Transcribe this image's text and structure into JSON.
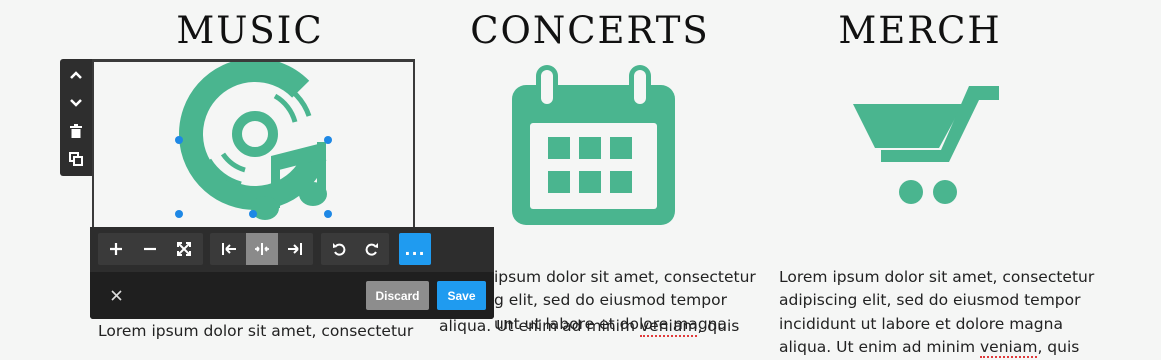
{
  "colors": {
    "accent_green": "#4ab58f",
    "toolbar_dark": "#2d2d2d",
    "active_blue": "#1f9bf0",
    "handle_blue": "#1e88e5",
    "discard_gray": "#8d8d8d"
  },
  "columns": [
    {
      "title": "MUSIC",
      "icon": "music-disc-icon",
      "text": "Lorem ipsum dolor sit amet, consectetur"
    },
    {
      "title": "CONCERTS",
      "icon": "calendar-icon",
      "lines": [
        "ipsum dolor sit amet, consectetur",
        "g elit, sed do eiusmod tempor",
        "unt ut labore et dolore magna",
        "aliqua. Ut enim ad minim ",
        "veniam",
        ", quis"
      ]
    },
    {
      "title": "MERCH",
      "icon": "shopping-cart-icon",
      "lines": [
        "Lorem ipsum dolor sit amet, consectetur",
        "adipiscing elit, sed do eiusmod tempor",
        "incididunt ut labore et dolore magna",
        "aliqua. Ut enim ad minim ",
        "veniam",
        ", quis"
      ]
    }
  ],
  "side_toolbar": {
    "items": [
      "move-up-icon",
      "move-down-icon",
      "delete-icon",
      "duplicate-icon"
    ]
  },
  "image_toolbar": {
    "zoom_group": [
      "zoom-in-icon",
      "zoom-out-icon",
      "fit-icon"
    ],
    "align_group": [
      "align-left-icon",
      "align-center-icon",
      "align-right-icon"
    ],
    "align_active": "align-center-icon",
    "history_group": [
      "undo-icon",
      "redo-icon"
    ],
    "more_label": "...",
    "close_icon": "close-icon",
    "discard_label": "Discard",
    "save_label": "Save"
  }
}
